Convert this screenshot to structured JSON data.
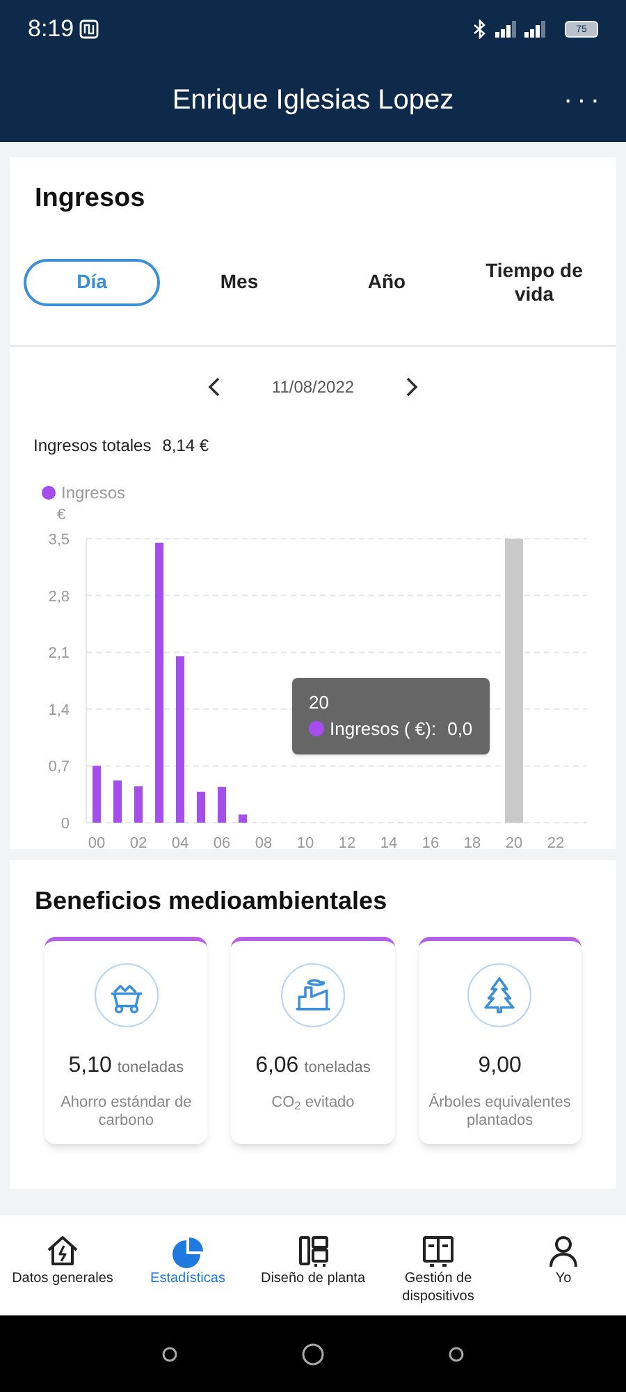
{
  "status_bar": {
    "time": "8:19",
    "battery": "75"
  },
  "header": {
    "title": "Enrique Iglesias Lopez",
    "menu": "···"
  },
  "income": {
    "title": "Ingresos",
    "tabs": [
      {
        "label": "Día",
        "selected": true
      },
      {
        "label": "Mes",
        "selected": false
      },
      {
        "label": "Año",
        "selected": false
      },
      {
        "label": "Tiempo de vida",
        "selected": false
      }
    ],
    "date": "11/08/2022",
    "total_label": "Ingresos totales",
    "total_value": "8,14 €",
    "chart_data": {
      "type": "bar",
      "ylabel": "€",
      "grid": true,
      "x": [
        0,
        1,
        2,
        3,
        4,
        5,
        6,
        7,
        8,
        9,
        10,
        11,
        12,
        13,
        14,
        15,
        16,
        17,
        18,
        19,
        20,
        21,
        22,
        23
      ],
      "series": [
        {
          "name": "Ingresos",
          "color": "#a64df0",
          "values": [
            0.7,
            0.52,
            0.45,
            3.45,
            2.05,
            0.38,
            0.44,
            0.1,
            0,
            0,
            0,
            0,
            0,
            0,
            0,
            0,
            0,
            0,
            0,
            0,
            0,
            0,
            0,
            0
          ]
        }
      ],
      "xlim": [
        -0.5,
        23.5
      ],
      "ylim": [
        0,
        3.5
      ],
      "yticks": [
        {
          "value": 0,
          "label": "0"
        },
        {
          "value": 0.7,
          "label": "0,7"
        },
        {
          "value": 1.4,
          "label": "1,4"
        },
        {
          "value": 2.1,
          "label": "2,1"
        },
        {
          "value": 2.8,
          "label": "2,8"
        },
        {
          "value": 3.5,
          "label": "3,5"
        }
      ],
      "xticks": [
        {
          "value": 0,
          "label": "00"
        },
        {
          "value": 2,
          "label": "02"
        },
        {
          "value": 4,
          "label": "04"
        },
        {
          "value": 6,
          "label": "06"
        },
        {
          "value": 8,
          "label": "08"
        },
        {
          "value": 10,
          "label": "10"
        },
        {
          "value": 12,
          "label": "12"
        },
        {
          "value": 14,
          "label": "14"
        },
        {
          "value": 16,
          "label": "16"
        },
        {
          "value": 18,
          "label": "18"
        },
        {
          "value": 20,
          "label": "20"
        },
        {
          "value": 22,
          "label": "22"
        }
      ],
      "bands": [
        {
          "axis": "x",
          "from": 19.5,
          "to": 20.5,
          "color": "#c9c9c9"
        }
      ]
    },
    "tooltip": {
      "title": "20",
      "label": "Ingresos ( €):",
      "value": "0,0"
    }
  },
  "benefits": {
    "title": "Beneficios medioambientales",
    "cards": [
      {
        "kind": "cart",
        "value": "5,10",
        "unit": "toneladas",
        "label": "Ahorro estándar de carbono"
      },
      {
        "kind": "factory",
        "value": "6,06",
        "unit": "toneladas",
        "label": "CO$_{2}$ evitado"
      },
      {
        "kind": "tree",
        "value": "9,00",
        "label": "Árboles equivalentes plantados"
      }
    ]
  },
  "bottom_nav": [
    {
      "kind": "home",
      "label": "Datos generales",
      "selected": false
    },
    {
      "kind": "pie",
      "label": "Estadísticas",
      "selected": true
    },
    {
      "kind": "layout",
      "label": "Diseño de planta",
      "selected": false
    },
    {
      "kind": "device",
      "label": "Gestión de dispositivos",
      "selected": false
    },
    {
      "kind": "person",
      "label": "Yo",
      "selected": false
    }
  ]
}
